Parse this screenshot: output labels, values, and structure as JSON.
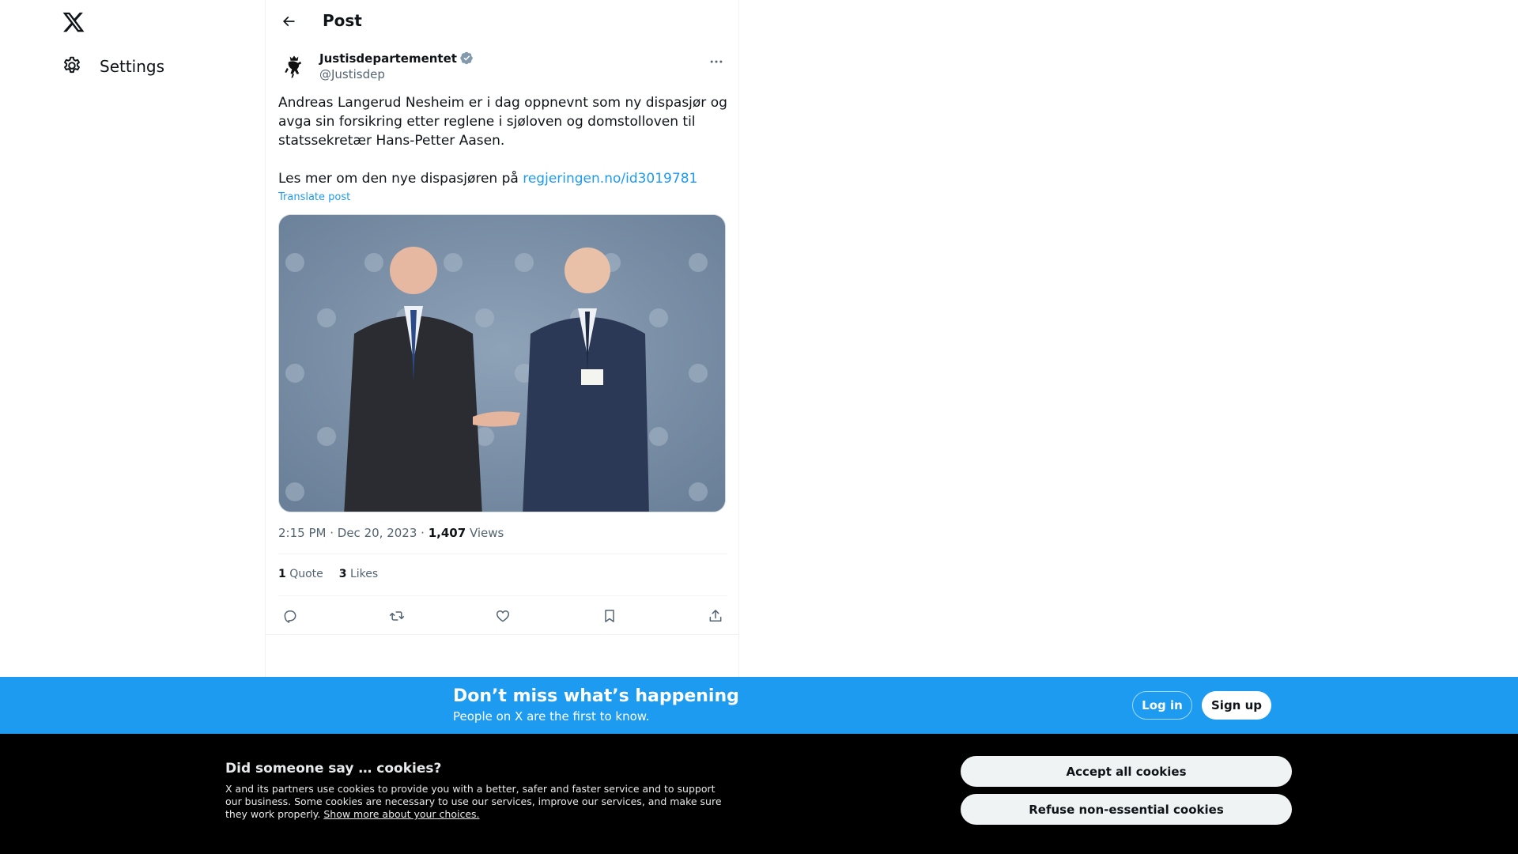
{
  "nav": {
    "settings_label": "Settings"
  },
  "header": {
    "title": "Post"
  },
  "post": {
    "author_name": "Justisdepartementet",
    "author_handle": "@Justisdep",
    "text_para1": "Andreas Langerud Nesheim er i dag oppnevnt som ny dispasjør og avga sin forsikring etter reglene i sjøloven og domstolloven til statssekretær Hans-Petter Aasen.",
    "text_para2_prefix": "Les mer om den nye dispasjøren på ",
    "text_link": "regjeringen.no/id3019781",
    "translate_label": "Translate post",
    "time": "2:15 PM",
    "date": "Dec 20, 2023",
    "views_count": "1,407",
    "views_label": "Views",
    "quote_count": "1",
    "quote_label": "Quote",
    "likes_count": "3",
    "likes_label": "Likes"
  },
  "signup_bar": {
    "title": "Don’t miss what’s happening",
    "subtitle": "People on X are the first to know.",
    "login_label": "Log in",
    "signup_label": "Sign up"
  },
  "cookies": {
    "title": "Did someone say … cookies?",
    "text": "X and its partners use cookies to provide you with a better, safer and faster service and to support our business. Some cookies are necessary to use our services, improve our services, and make sure they work properly. ",
    "link_label": "Show more about your choices.",
    "accept_label": "Accept all cookies",
    "refuse_label": "Refuse non-essential cookies"
  },
  "colors": {
    "accent": "#1d9bf0",
    "text_primary": "#0f1419",
    "text_secondary": "#536471",
    "cookie_bg": "#000000"
  }
}
